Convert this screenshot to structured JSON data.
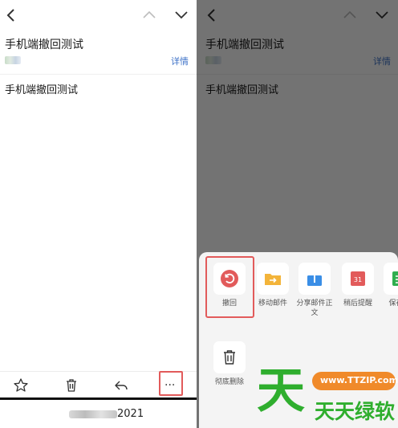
{
  "email": {
    "subject": "手机端撤回测试",
    "details_link": "详情",
    "body": "手机端撤回测试",
    "footer_year": "2021"
  },
  "toolbar": {
    "icons": [
      "star-icon",
      "trash-icon",
      "reply-icon",
      "more-icon"
    ],
    "more_label": "···"
  },
  "action_sheet": {
    "row1": [
      {
        "label": "撤回",
        "icon": "undo-icon",
        "color": "#e25b5b"
      },
      {
        "label": "移动邮件",
        "icon": "folder-move-icon",
        "color": "#f3b43a"
      },
      {
        "label": "分享邮件正文",
        "icon": "share-icon",
        "color": "#3a8ee6"
      },
      {
        "label": "稍后提醒",
        "icon": "calendar-icon",
        "color": "#e25b5b",
        "badge": "31"
      },
      {
        "label": "保存到",
        "icon": "save-icon",
        "color": "#2fae4e"
      }
    ],
    "row2": [
      {
        "label": "彻底删除",
        "icon": "trash-icon"
      }
    ]
  },
  "watermark": {
    "glyph": "天",
    "site": "www.TTZIP.com",
    "brand": "天天绿软"
  },
  "colors": {
    "link": "#3f73c8",
    "highlight": "#e25b5b",
    "watermark_green": "#2fae2e",
    "watermark_orange": "#f08a2a"
  }
}
